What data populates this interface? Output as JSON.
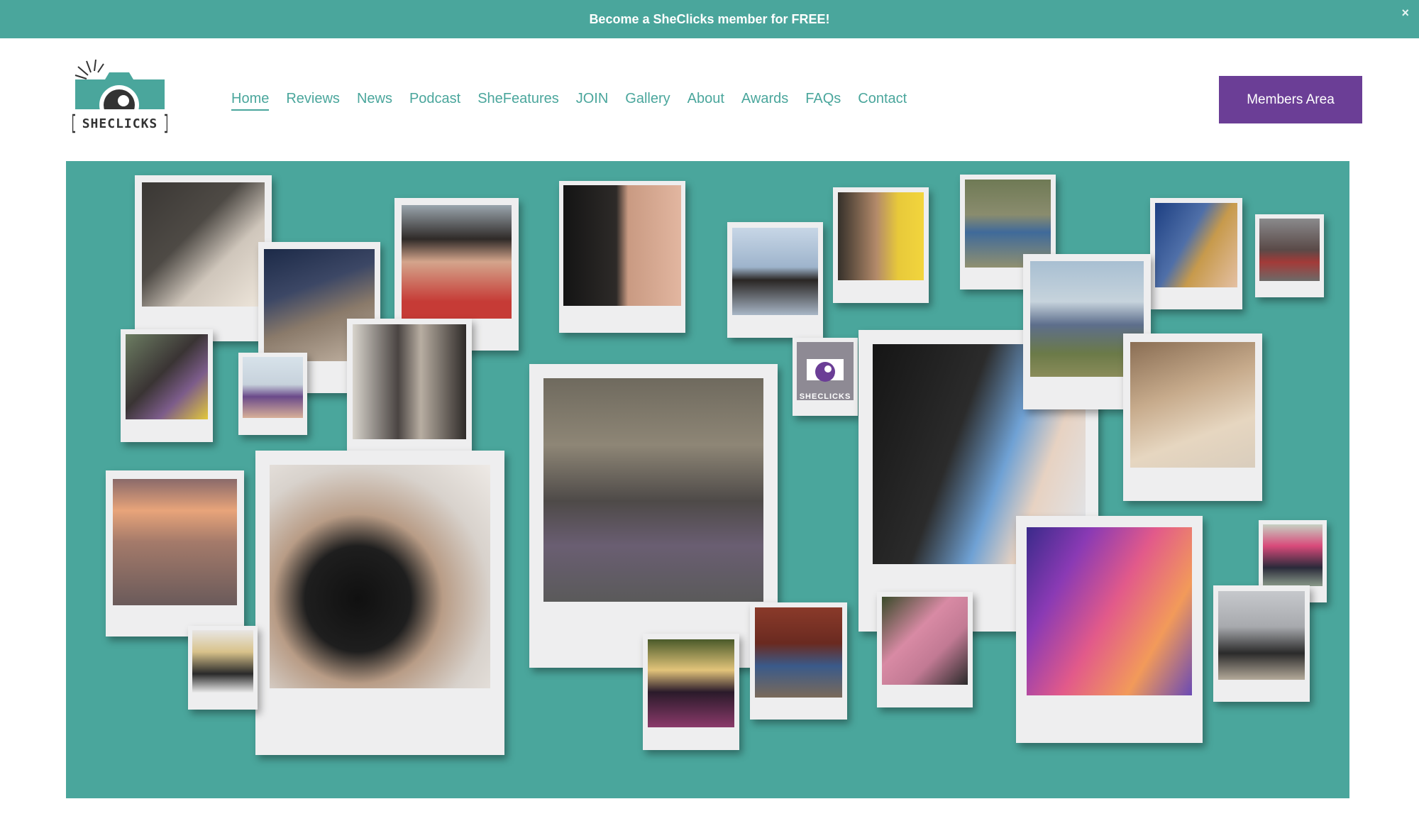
{
  "banner": {
    "text": "Become a SheClicks member for FREE!",
    "close_glyph": "×"
  },
  "logo": {
    "wordmark": "SHECLICKS",
    "icon": "camera-icon",
    "colors": {
      "teal": "#4aa69c",
      "dark": "#333333"
    }
  },
  "nav": {
    "items": [
      {
        "label": "Home",
        "active": true
      },
      {
        "label": "Reviews"
      },
      {
        "label": "News"
      },
      {
        "label": "Podcast"
      },
      {
        "label": "SheFeatures"
      },
      {
        "label": "JOIN"
      },
      {
        "label": "Gallery"
      },
      {
        "label": "About"
      },
      {
        "label": "Awards"
      },
      {
        "label": "FAQs"
      },
      {
        "label": "Contact"
      }
    ]
  },
  "members_button": {
    "label": "Members Area"
  },
  "hero": {
    "background": "#4aa69c",
    "collage_logo_text": "SHECLICKS"
  },
  "colors": {
    "accent_teal": "#4aa69c",
    "accent_purple": "#6b3e96"
  }
}
